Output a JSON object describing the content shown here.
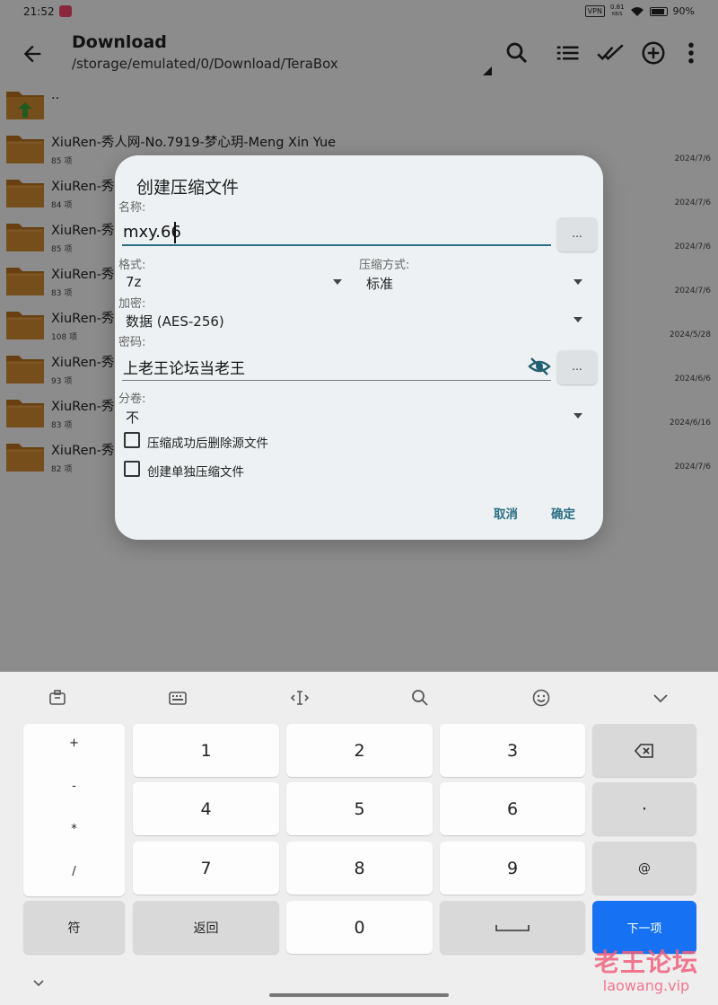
{
  "status_bar": {
    "time": "21:52",
    "vpn": "VPN",
    "net_speed_value": "0.81",
    "net_speed_unit": "KB/S",
    "battery": "90%"
  },
  "toolbar": {
    "title": "Download",
    "path": "/storage/emulated/0/Download/TeraBox"
  },
  "file_list": {
    "parent": "..",
    "items": [
      {
        "name": "XiuRen-秀人网-No.7919-梦心玥-Meng Xin Yue",
        "count": "85 项",
        "date": "2024/7/6"
      },
      {
        "name": "XiuRen-秀",
        "count": "84 项",
        "date": "2024/7/6"
      },
      {
        "name": "XiuRen-秀",
        "count": "85 项",
        "date": "2024/7/6"
      },
      {
        "name": "XiuRen-秀",
        "count": "83 项",
        "date": "2024/7/6"
      },
      {
        "name": "XiuRen-秀",
        "count": "108 项",
        "date": "2024/5/28"
      },
      {
        "name": "XiuRen-秀",
        "count": "93 项",
        "date": "2024/6/6"
      },
      {
        "name": "XiuRen-秀",
        "count": "83 项",
        "date": "2024/6/16"
      },
      {
        "name": "XiuRen-秀",
        "count": "82 项",
        "date": "2024/7/6"
      }
    ]
  },
  "dialog": {
    "title": "创建压缩文件",
    "name_label": "名称:",
    "name_value": "mxy.66",
    "more_label": "...",
    "format_label": "格式:",
    "format_value": "7z",
    "method_label": "压缩方式:",
    "method_value": "标准",
    "encrypt_label": "加密:",
    "encrypt_value": "数据 (AES-256)",
    "password_label": "密码:",
    "password_value": "上老王论坛当老王",
    "split_label": "分卷:",
    "split_value": "不",
    "delete_source_label": "压缩成功后删除源文件",
    "separate_archives_label": "创建单独压缩文件",
    "cancel_label": "取消",
    "ok_label": "确定"
  },
  "keyboard": {
    "symbols": [
      "+",
      "-",
      "*",
      "/"
    ],
    "digits": [
      "1",
      "2",
      "3",
      "4",
      "5",
      "6",
      "7",
      "8",
      "9",
      "0"
    ],
    "dot": "·",
    "at": "@",
    "symbol_key": "符",
    "back_key": "返回",
    "next_key": "下一项",
    "accent_color": "#1672f3"
  },
  "watermark": {
    "cn": "老王论坛",
    "en": "laowang.vip"
  }
}
